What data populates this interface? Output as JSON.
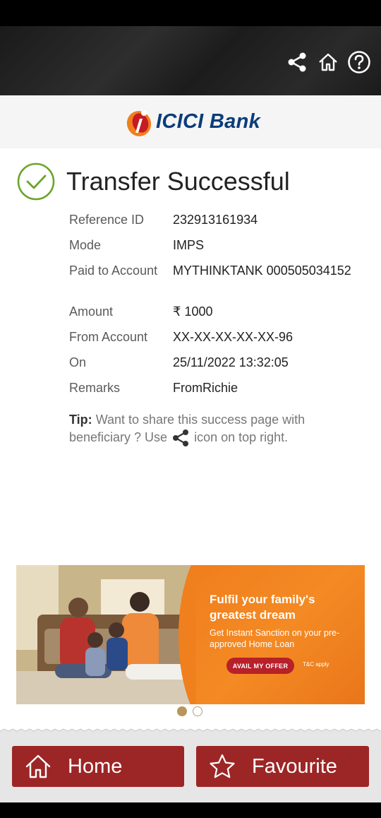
{
  "header": {
    "icons": [
      "share-icon",
      "home-icon",
      "help-icon"
    ]
  },
  "brand": {
    "name": "ICICI Bank",
    "colors": {
      "blue": "#0b3d7a",
      "orange": "#f07f1d",
      "red": "#c61b24"
    }
  },
  "result": {
    "title": "Transfer Successful",
    "status_color": "#6aa52a"
  },
  "details": [
    {
      "label": "Reference ID",
      "value": "232913161934"
    },
    {
      "label": "Mode",
      "value": "IMPS"
    },
    {
      "label": "Paid to Account",
      "value": "MYTHINKTANK 000505034152"
    },
    {
      "label": "Amount",
      "value": "₹ 1000"
    },
    {
      "label": "From Account",
      "value": "XX-XX-XX-XX-XX-96"
    },
    {
      "label": "On",
      "value": "25/11/2022 13:32:05"
    },
    {
      "label": "Remarks",
      "value": "FromRichie"
    }
  ],
  "tip": {
    "prefix": "Tip:",
    "text_before": "Want to share this success page with beneficiary ? Use",
    "text_after": "icon on top right."
  },
  "banner": {
    "title": "Fulfil your family's greatest dream",
    "subtitle": "Get Instant Sanction on your pre-approved Home Loan",
    "button": "AVAIL MY OFFER",
    "terms": "T&C apply",
    "pagination": {
      "total": 2,
      "active": 1
    }
  },
  "footer": {
    "home_label": "Home",
    "favourite_label": "Favourite",
    "button_color": "#9c2626"
  }
}
